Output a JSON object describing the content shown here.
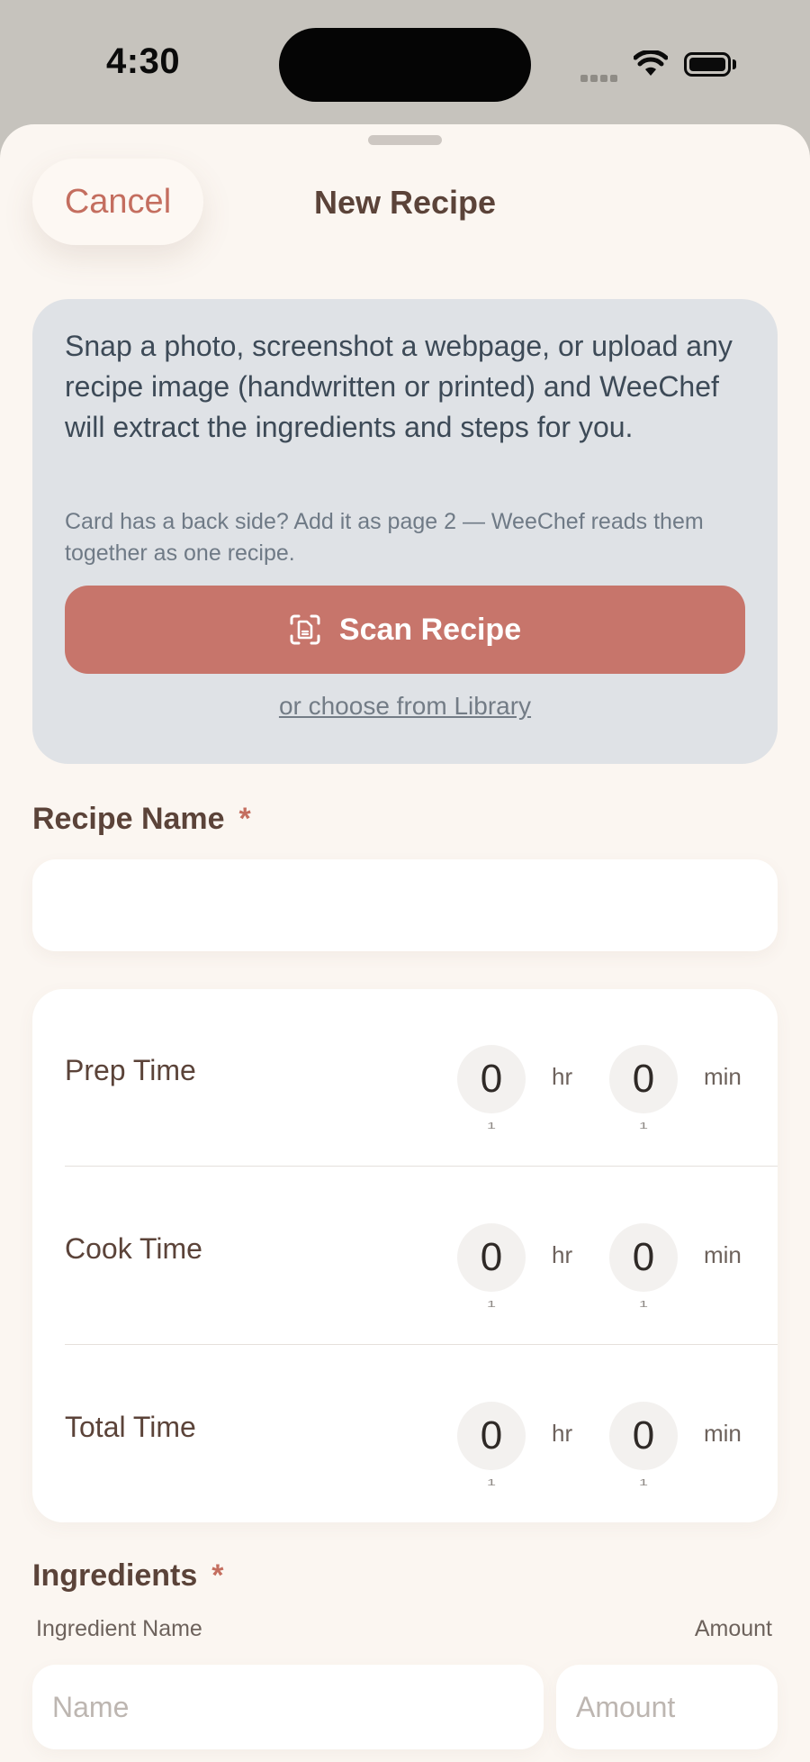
{
  "status_bar": {
    "time": "4:30"
  },
  "header": {
    "cancel_label": "Cancel",
    "title": "New Recipe"
  },
  "scan_card": {
    "description": "Snap a photo, screenshot a webpage, or upload any recipe image (handwritten or printed) and WeeChef will extract the ingredients and steps for you.",
    "note": "Card has a back side? Add it as page 2 — WeeChef reads them together as one recipe.",
    "scan_button_label": "Scan Recipe",
    "scan_icon": "document-scan-icon",
    "library_link": "or choose from Library"
  },
  "recipe_name": {
    "label": "Recipe Name",
    "required_mark": "*",
    "value": ""
  },
  "times": {
    "prep": {
      "label": "Prep Time",
      "hours": "0",
      "minutes": "0",
      "hours_next": "1",
      "minutes_next": "1"
    },
    "cook": {
      "label": "Cook Time",
      "hours": "0",
      "minutes": "0",
      "hours_next": "1",
      "minutes_next": "1"
    },
    "total": {
      "label": "Total Time",
      "hours": "0",
      "minutes": "0",
      "hours_next": "1",
      "minutes_next": "1"
    },
    "hr_unit": "hr",
    "min_unit": "min"
  },
  "ingredients": {
    "label": "Ingredients",
    "required_mark": "*",
    "name_header": "Ingredient Name",
    "amount_header": "Amount",
    "name_placeholder": "Name",
    "amount_placeholder": "Amount"
  },
  "colors": {
    "accent": "#c7756b",
    "title": "#5b4339",
    "card": "#dfe2e6",
    "sheet": "#fbf6f1"
  }
}
